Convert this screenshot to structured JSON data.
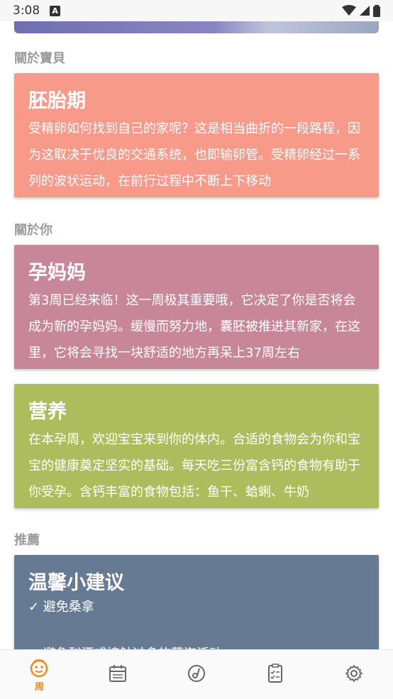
{
  "status_bar": {
    "time": "3:08",
    "notification_badge": "A"
  },
  "sections": [
    {
      "label": "關於寶貝"
    },
    {
      "label": "關於你"
    },
    {
      "label": "推薦"
    }
  ],
  "cards": [
    {
      "title": "胚胎期",
      "text": "受精卵如何找到自己的家呢？这是相当曲折的一段路程，因为这取决于优良的交通系统，也即输卵管。受精卵经过一系列的波状运动，在前行过程中不断上下移动",
      "color": "#f79a8a"
    },
    {
      "title": "孕妈妈",
      "text": "第3周已经来临！这一周极其重要哦，它决定了你是否将会成为新的孕妈妈。缓慢而努力地，囊胚被推进其新家，在这里，它将会寻找一块舒适的地方再呆上37周左右",
      "color": "#c88799"
    },
    {
      "title": "营养",
      "text": "在本孕周，欢迎宝宝来到你的体内。合适的食物会为你和宝宝的健康奠定坚实的基础。每天吃三份富含钙的食物有助于你受孕。含钙丰富的食物包括：鱼干、蛤蜊、牛奶",
      "color": "#adbd5d"
    },
    {
      "title": "温馨小建议",
      "line1": "✓ 避免桑拿",
      "line2": "✓ 避免酗酒或接触过多的蒸汽活动",
      "color": "#677a94"
    }
  ],
  "bottom_nav": {
    "active_label": "周",
    "accent_color": "#f08a18",
    "items": [
      "smile-icon",
      "calendar-icon",
      "music-disc-icon",
      "checklist-icon",
      "gear-icon"
    ]
  }
}
